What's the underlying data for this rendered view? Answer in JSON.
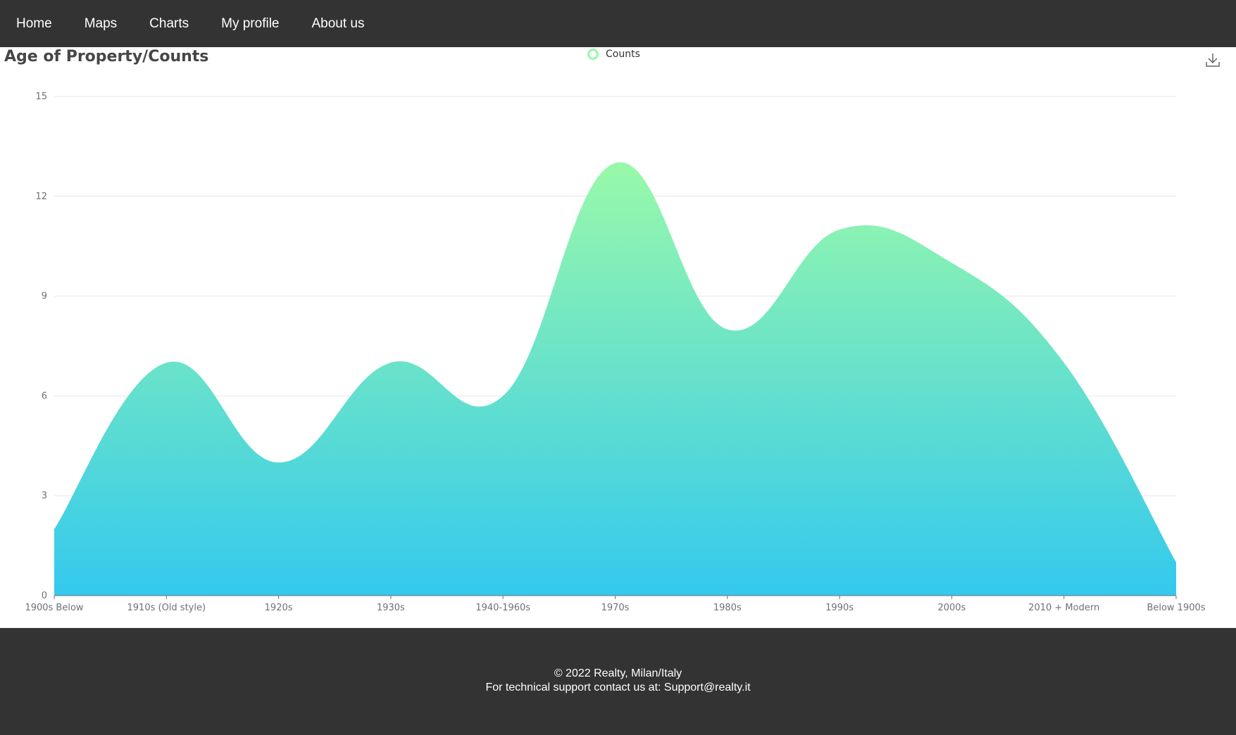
{
  "nav": {
    "items": [
      {
        "label": "Home"
      },
      {
        "label": "Maps"
      },
      {
        "label": "Charts"
      },
      {
        "label": "My profile"
      },
      {
        "label": "About us"
      }
    ]
  },
  "chart_data": {
    "type": "area",
    "title": "Age of Property/Counts",
    "categories": [
      "1900s Below",
      "1910s (Old style)",
      "1920s",
      "1930s",
      "1940-1960s",
      "1970s",
      "1980s",
      "1990s",
      "2000s",
      "2010 + Modern",
      "Below 1900s"
    ],
    "series": [
      {
        "name": "Counts",
        "values": [
          2,
          7,
          4,
          7,
          6,
          13,
          8,
          11,
          10,
          7,
          1
        ]
      }
    ],
    "xlabel": "",
    "ylabel": "",
    "ylim": [
      0,
      15
    ],
    "yticks": [
      0,
      3,
      6,
      9,
      12,
      15
    ],
    "smooth": true,
    "grid": true,
    "legend_position": "top-center",
    "colors": {
      "gradient_top": "#99f9a9",
      "gradient_bottom": "#33c9ee",
      "legend": "#99f8ab",
      "grid": "#e6e6e6",
      "axis": "#6e7079"
    }
  },
  "toolbar": {
    "download_icon": "download-icon"
  },
  "footer": {
    "copyright": "© 2022 Realty, Milan/Italy",
    "support": "For technical support contact us at: Support@realty.it"
  }
}
